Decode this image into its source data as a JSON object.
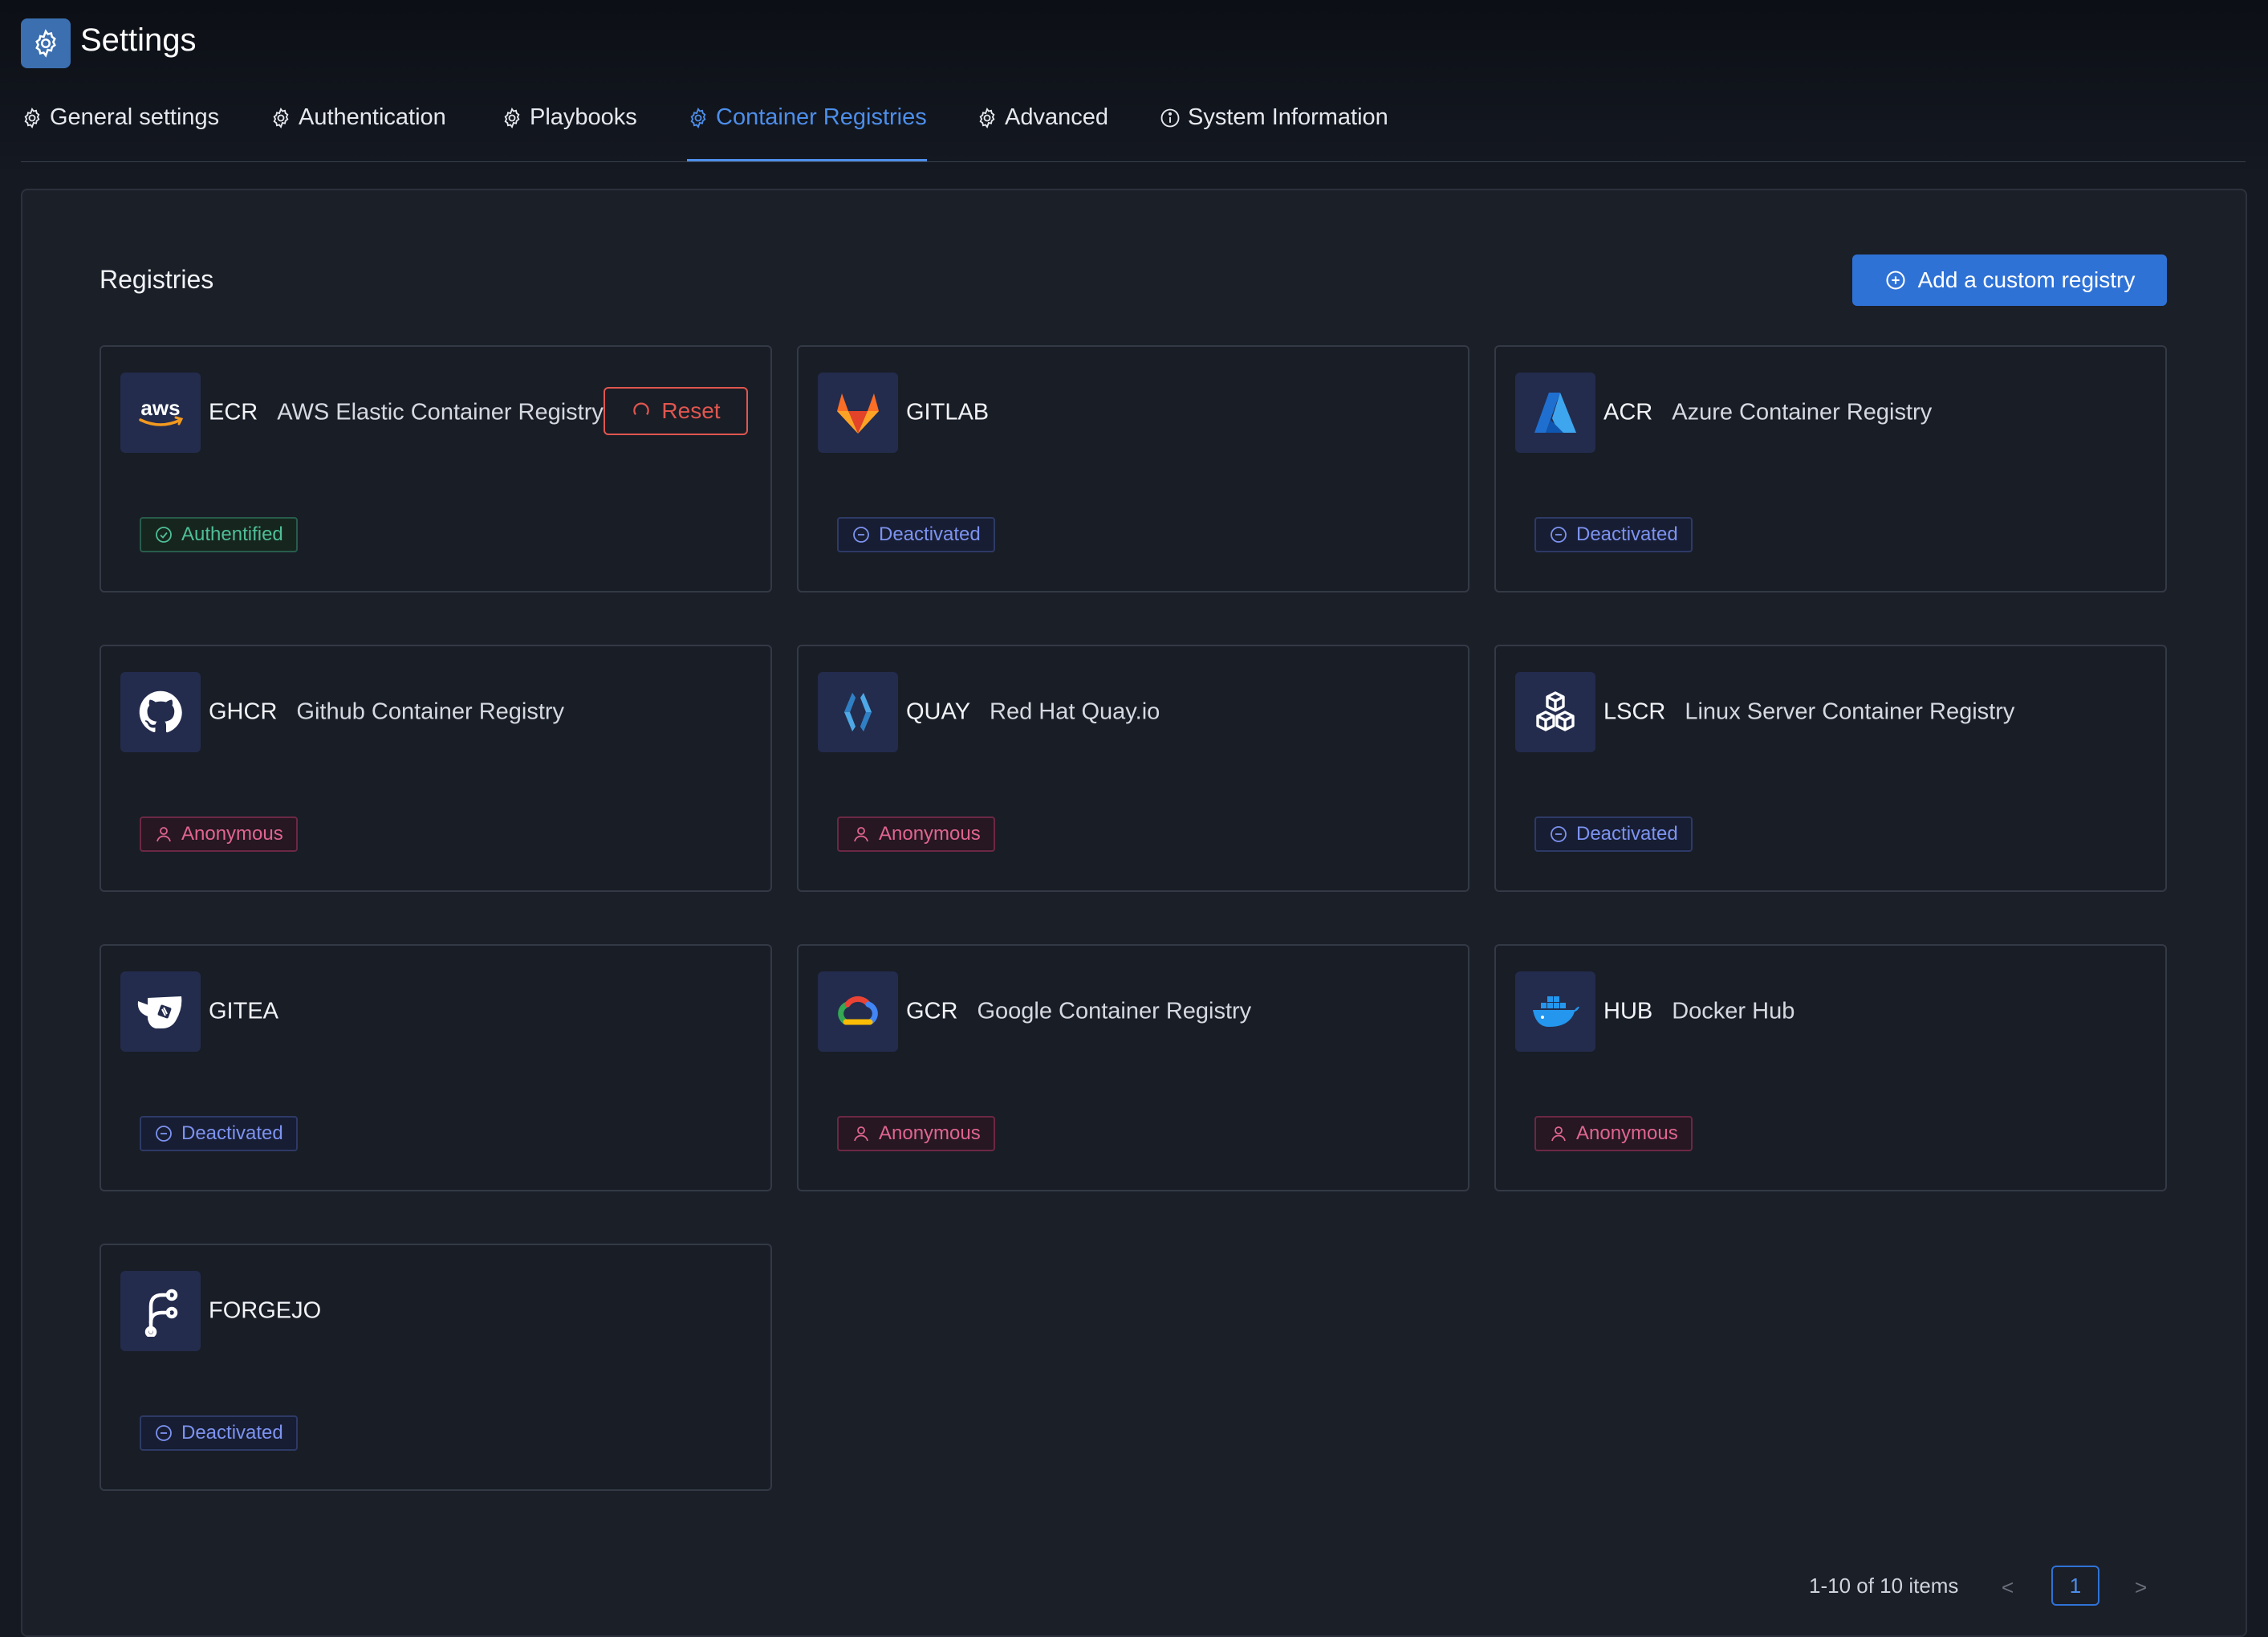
{
  "header": {
    "title": "Settings",
    "logo_icon": "gear-icon"
  },
  "tabs": [
    {
      "label": "General settings",
      "icon": "gear-icon",
      "active": false
    },
    {
      "label": "Authentication",
      "icon": "gear-icon",
      "active": false
    },
    {
      "label": "Playbooks",
      "icon": "gear-icon",
      "active": false
    },
    {
      "label": "Container Registries",
      "icon": "gear-icon",
      "active": true
    },
    {
      "label": "Advanced",
      "icon": "gear-icon",
      "active": false
    },
    {
      "label": "System Information",
      "icon": "info-icon",
      "active": false
    }
  ],
  "section": {
    "title": "Registries",
    "add_button_label": "Add a custom registry",
    "add_button_icon": "plus-circle-icon"
  },
  "registries": [
    {
      "code": "ECR",
      "name": "AWS Elastic Container Registry",
      "logo": "aws-logo-icon",
      "status": "Authentified",
      "status_type": "authentified",
      "reset_label": "Reset"
    },
    {
      "code": "GITLAB",
      "name": "",
      "logo": "gitlab-logo-icon",
      "status": "Deactivated",
      "status_type": "deactivated"
    },
    {
      "code": "ACR",
      "name": "Azure Container Registry",
      "logo": "azure-logo-icon",
      "status": "Deactivated",
      "status_type": "deactivated"
    },
    {
      "code": "GHCR",
      "name": "Github Container Registry",
      "logo": "github-logo-icon",
      "status": "Anonymous",
      "status_type": "anonymous"
    },
    {
      "code": "QUAY",
      "name": "Red Hat Quay.io",
      "logo": "quay-logo-icon",
      "status": "Anonymous",
      "status_type": "anonymous"
    },
    {
      "code": "LSCR",
      "name": "Linux Server Container Registry",
      "logo": "cubes-logo-icon",
      "status": "Deactivated",
      "status_type": "deactivated"
    },
    {
      "code": "GITEA",
      "name": "",
      "logo": "gitea-logo-icon",
      "status": "Deactivated",
      "status_type": "deactivated"
    },
    {
      "code": "GCR",
      "name": "Google Container Registry",
      "logo": "google-cloud-logo-icon",
      "status": "Anonymous",
      "status_type": "anonymous"
    },
    {
      "code": "HUB",
      "name": "Docker Hub",
      "logo": "docker-logo-icon",
      "status": "Anonymous",
      "status_type": "anonymous"
    },
    {
      "code": "FORGEJO",
      "name": "",
      "logo": "forgejo-logo-icon",
      "status": "Deactivated",
      "status_type": "deactivated"
    }
  ],
  "pagination": {
    "info": "1-10 of 10 items",
    "current_page": "1",
    "prev": "<",
    "next": ">"
  },
  "colors": {
    "accent": "#4d8eea",
    "button": "#2f72d6",
    "danger": "#e0564f",
    "authentified": "#4fbf96",
    "deactivated": "#7d93f0",
    "anonymous": "#e0658f"
  }
}
